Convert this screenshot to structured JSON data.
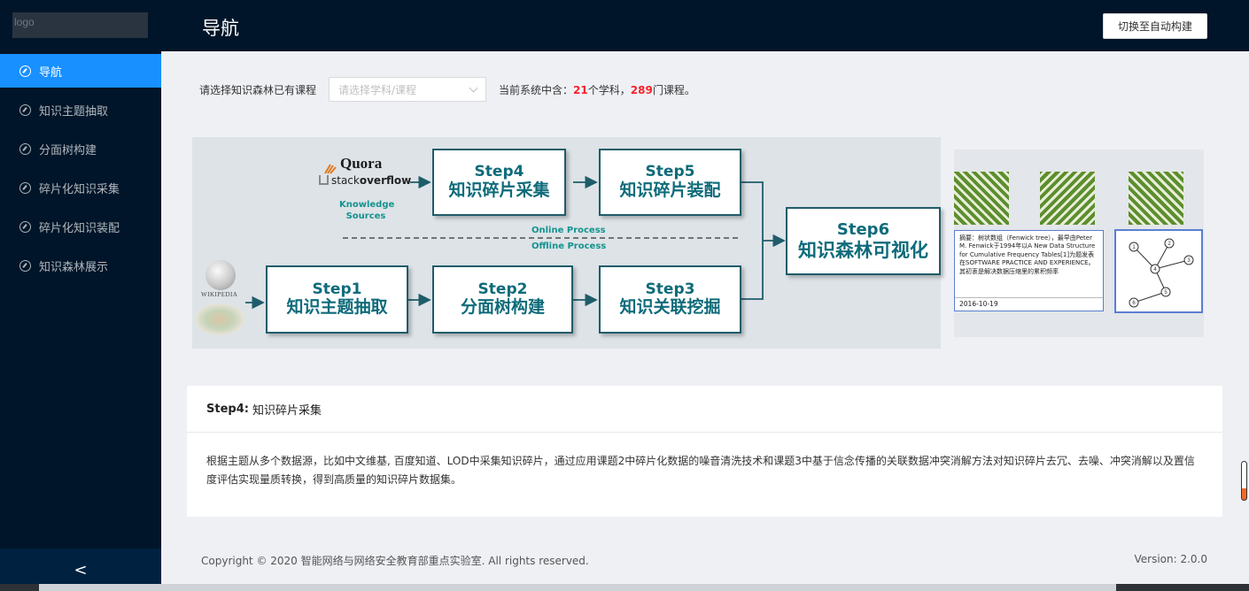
{
  "sidebar": {
    "logo": "logo",
    "items": [
      {
        "label": "导航",
        "active": true
      },
      {
        "label": "知识主题抽取",
        "active": false
      },
      {
        "label": "分面树构建",
        "active": false
      },
      {
        "label": "碎片化知识采集",
        "active": false
      },
      {
        "label": "碎片化知识装配",
        "active": false
      },
      {
        "label": "知识森林展示",
        "active": false
      }
    ],
    "collapse_glyph": "<"
  },
  "header": {
    "title": "导航",
    "switch_label": "切换至自动构建"
  },
  "course_select": {
    "label": "请选择知识森林已有课程",
    "placeholder": "请选择学科/课程",
    "stats_prefix": "当前系统中含：",
    "subjects": "21",
    "subjects_unit": "个学科，",
    "courses": "289",
    "courses_unit": "门课程。"
  },
  "pipeline": {
    "step1": {
      "num": "Step1",
      "name": "知识主题抽取"
    },
    "step2": {
      "num": "Step2",
      "name": "分面树构建"
    },
    "step3": {
      "num": "Step3",
      "name": "知识关联挖掘"
    },
    "step4": {
      "num": "Step4",
      "name": "知识碎片采集"
    },
    "step5": {
      "num": "Step5",
      "name": "知识碎片装配"
    },
    "step6": {
      "num": "Step6",
      "name": "知识森林可视化"
    },
    "quora": "Quora",
    "stackoverflow_prefix": "stack",
    "stackoverflow_bold": "overflow",
    "knowledge_sources_1": "Knowledge",
    "knowledge_sources_2": "Sources",
    "online": "Online Process",
    "offline": "Offline Process",
    "wikipedia": "WIKIPEDIA"
  },
  "illustration": {
    "abstract_text": "摘要：树状数组（Fenwick tree），最早由Peter M. Fenwick于1994年以A New Data Structure for Cumulative Frequency Tables[1]为题发表在SOFTWARE PRACTICE AND EXPERIENCE。其初衷是解决数据压缩里的累积频率",
    "abstract_date": "2016-10-19",
    "tree_nodes": [
      "1",
      "2",
      "3",
      "4",
      "5",
      "6"
    ]
  },
  "card": {
    "title_bold": "Step4:",
    "title_rest": "知识碎片采集",
    "body": "根据主题从多个数据源，比如中文维基, 百度知道、LOD中采集知识碎片，通过应用课题2中碎片化数据的噪音清洗技术和课题3中基于信念传播的关联数据冲突消解方法对知识碎片去冗、去噪、冲突消解以及置信度评估实现量质转换，得到高质量的知识碎片数据集。"
  },
  "footer": {
    "copyright": "Copyright © 2020 智能网络与网络安全教育部重点实验室. All rights reserved.",
    "version": "Version: 2.0.0"
  },
  "colors": {
    "sidebar_bg": "#001529",
    "active_item": "#1890ff",
    "stat_number": "#f5222d",
    "step_text": "#0e6b7a",
    "source_text": "#14928f"
  }
}
